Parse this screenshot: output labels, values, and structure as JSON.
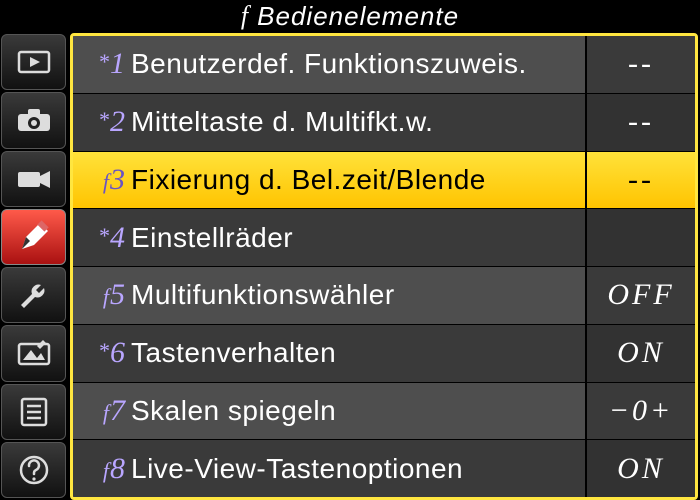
{
  "header": {
    "prefix": "f",
    "title": "Bedienelemente"
  },
  "sidebar": {
    "items": [
      {
        "name": "playback-icon"
      },
      {
        "name": "camera-icon"
      },
      {
        "name": "video-icon"
      },
      {
        "name": "pencil-icon",
        "selected": true
      },
      {
        "name": "wrench-icon"
      },
      {
        "name": "retouch-icon"
      },
      {
        "name": "mymenu-icon"
      },
      {
        "name": "help-icon"
      }
    ]
  },
  "menu": {
    "items": [
      {
        "codePrefix": "*",
        "codeNum": "1",
        "label": "Benutzerdef. Funktionszuweis.",
        "value": "--"
      },
      {
        "codePrefix": "*",
        "codeNum": "2",
        "label": "Mitteltaste d. Multifkt.w.",
        "value": "--"
      },
      {
        "codePrefix": "f",
        "codeNum": "3",
        "label": "Fixierung d. Bel.zeit/Blende",
        "value": "--",
        "selected": true
      },
      {
        "codePrefix": "*",
        "codeNum": "4",
        "label": "Einstellräder",
        "value": ""
      },
      {
        "codePrefix": "f",
        "codeNum": "5",
        "label": "Multifunktionswähler",
        "value": "OFF"
      },
      {
        "codePrefix": "*",
        "codeNum": "6",
        "label": "Tastenverhalten",
        "value": "ON"
      },
      {
        "codePrefix": "f",
        "codeNum": "7",
        "label": "Skalen spiegeln",
        "value": "−0+"
      },
      {
        "codePrefix": "f",
        "codeNum": "8",
        "label": "Live-View-Tastenoptionen",
        "value": "ON"
      }
    ]
  }
}
